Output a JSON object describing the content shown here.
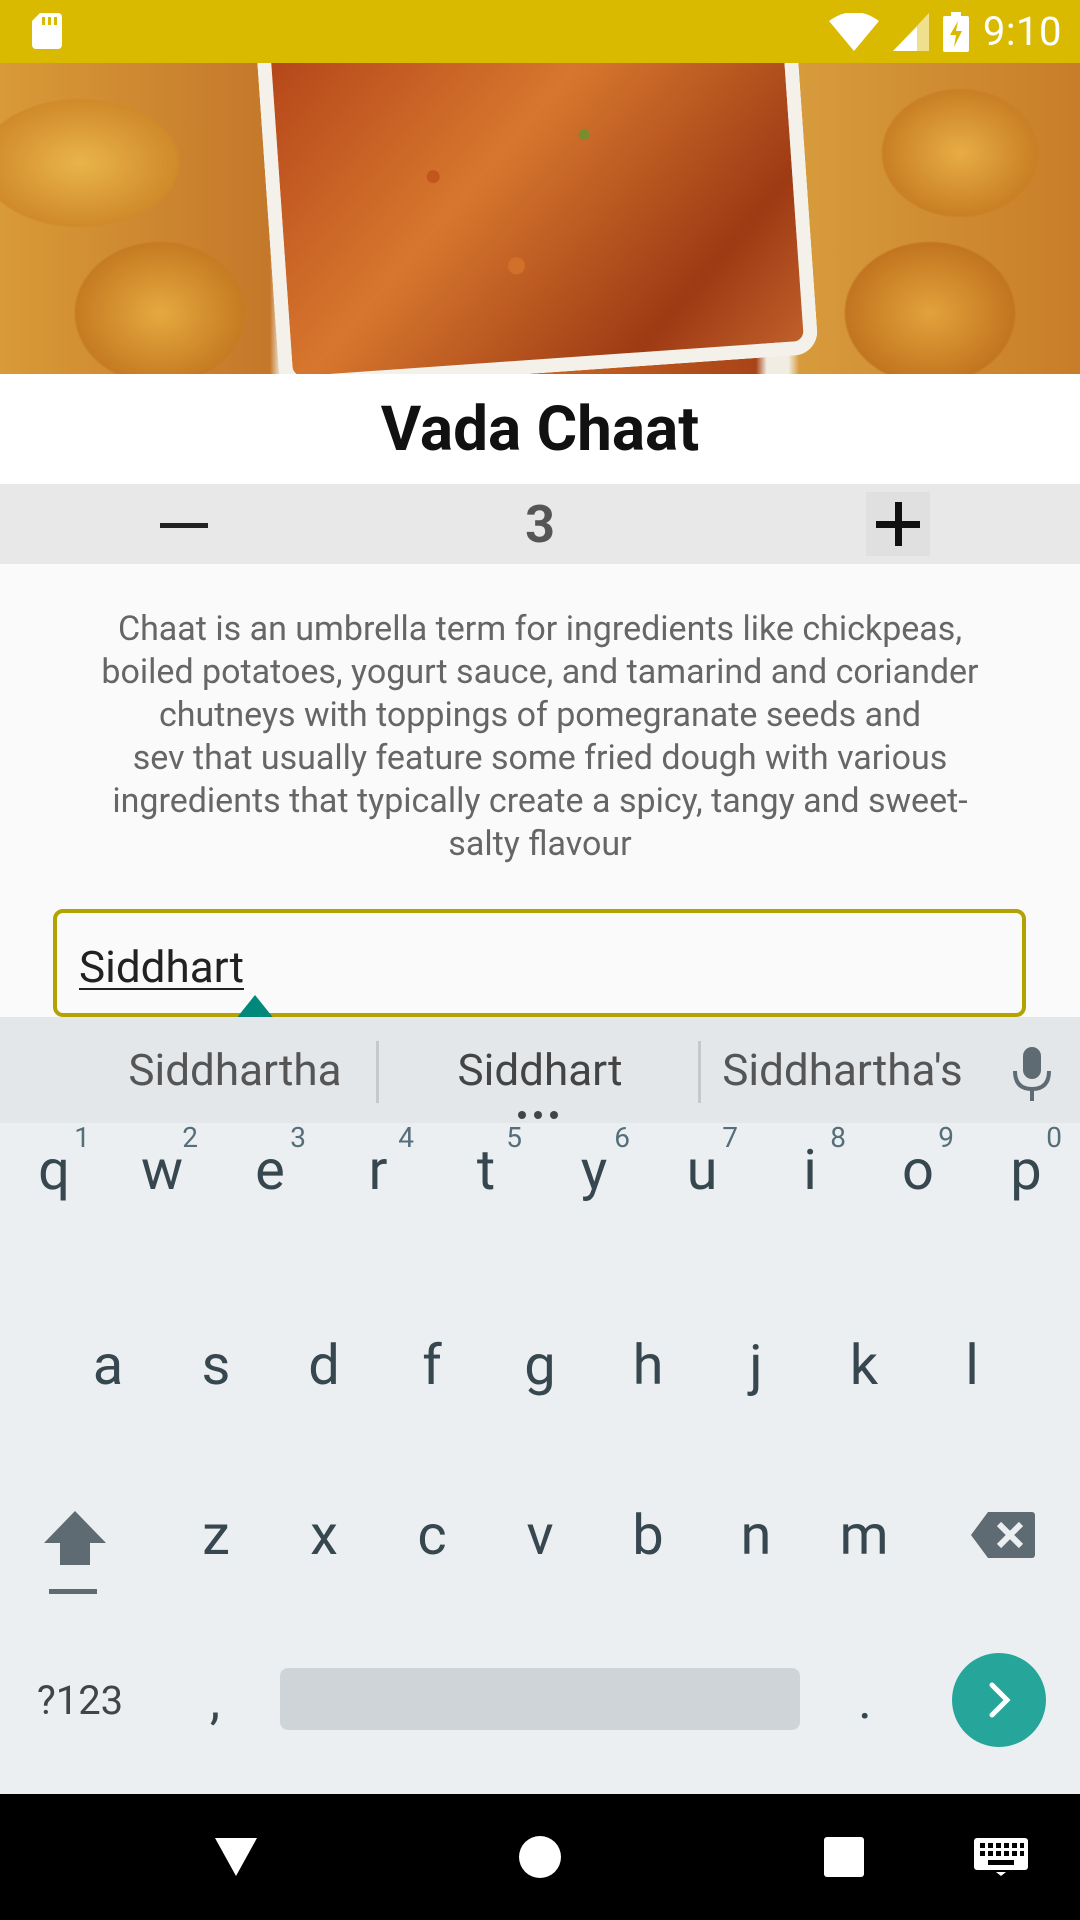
{
  "status_bar": {
    "time": "9:10",
    "colors": {
      "background": "#d9ba00"
    }
  },
  "recipe": {
    "image_icon": "dish-photo",
    "title": "Vada Chaat",
    "quantity": "3",
    "description": "Chaat is an umbrella term for ingredients like chickpeas,\nboiled potatoes, yogurt sauce, and tamarind and coriander\nchutneys with toppings of pomegranate seeds and\nsev  that usually feature some fried dough with various\ningredients that typically create a spicy, tangy and sweet-\nsalty flavour"
  },
  "name_input": {
    "value": "Siddhart",
    "border_color": "#b3a200"
  },
  "keyboard": {
    "suggestions": [
      "Siddhartha",
      "Siddhart",
      "Siddhartha's"
    ],
    "row1": [
      {
        "k": "q",
        "h": "1"
      },
      {
        "k": "w",
        "h": "2"
      },
      {
        "k": "e",
        "h": "3"
      },
      {
        "k": "r",
        "h": "4"
      },
      {
        "k": "t",
        "h": "5"
      },
      {
        "k": "y",
        "h": "6"
      },
      {
        "k": "u",
        "h": "7"
      },
      {
        "k": "i",
        "h": "8"
      },
      {
        "k": "o",
        "h": "9"
      },
      {
        "k": "p",
        "h": "0"
      }
    ],
    "row2": [
      "a",
      "s",
      "d",
      "f",
      "g",
      "h",
      "j",
      "k",
      "l"
    ],
    "row3": [
      "z",
      "x",
      "c",
      "v",
      "b",
      "n",
      "m"
    ],
    "symbols_label": "?123",
    "comma_label": ",",
    "period_label": ".",
    "accent_color": "#26a69a"
  }
}
